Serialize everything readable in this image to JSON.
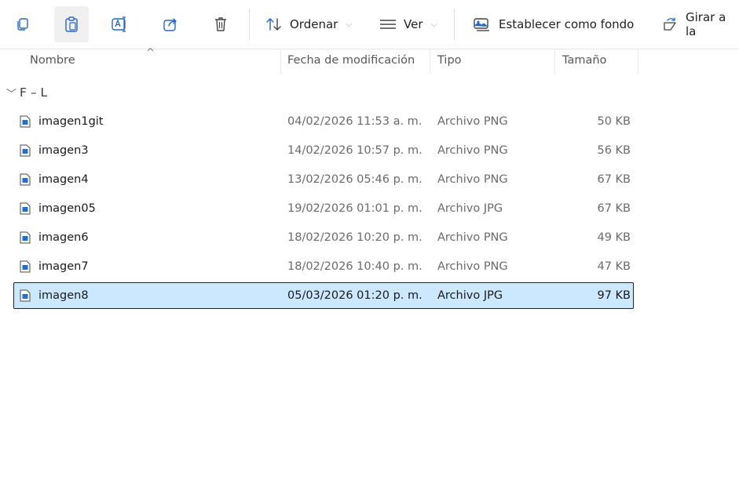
{
  "toolbar": {
    "sort_label": "Ordenar",
    "view_label": "Ver",
    "set_background_label": "Establecer como fondo",
    "rotate_label": "Girar a la"
  },
  "columns": {
    "name": "Nombre",
    "date": "Fecha de modificación",
    "type": "Tipo",
    "size": "Tamaño"
  },
  "group": {
    "label": "F – L",
    "chevron": "﹀"
  },
  "files": [
    {
      "name": "imagen1git",
      "date": "04/02/2026 11:53 a. m.",
      "type": "Archivo PNG",
      "size": "50 KB"
    },
    {
      "name": "imagen3",
      "date": "14/02/2026 10:57 p. m.",
      "type": "Archivo PNG",
      "size": "56 KB"
    },
    {
      "name": "imagen4",
      "date": "13/02/2026 05:46 p. m.",
      "type": "Archivo PNG",
      "size": "67 KB"
    },
    {
      "name": "imagen05",
      "date": "19/02/2026 01:01 p. m.",
      "type": "Archivo JPG",
      "size": "67 KB"
    },
    {
      "name": "imagen6",
      "date": "18/02/2026 10:20 p. m.",
      "type": "Archivo PNG",
      "size": "49 KB"
    },
    {
      "name": "imagen7",
      "date": "18/02/2026 10:40 p. m.",
      "type": "Archivo PNG",
      "size": "47 KB"
    },
    {
      "name": "imagen8",
      "date": "05/03/2026 01:20 p. m.",
      "type": "Archivo JPG",
      "size": "97 KB"
    }
  ],
  "selected_file": "imagen8",
  "colors": {
    "selection_bg": "#cce8ff",
    "accent_blue": "#1f6fd1"
  }
}
